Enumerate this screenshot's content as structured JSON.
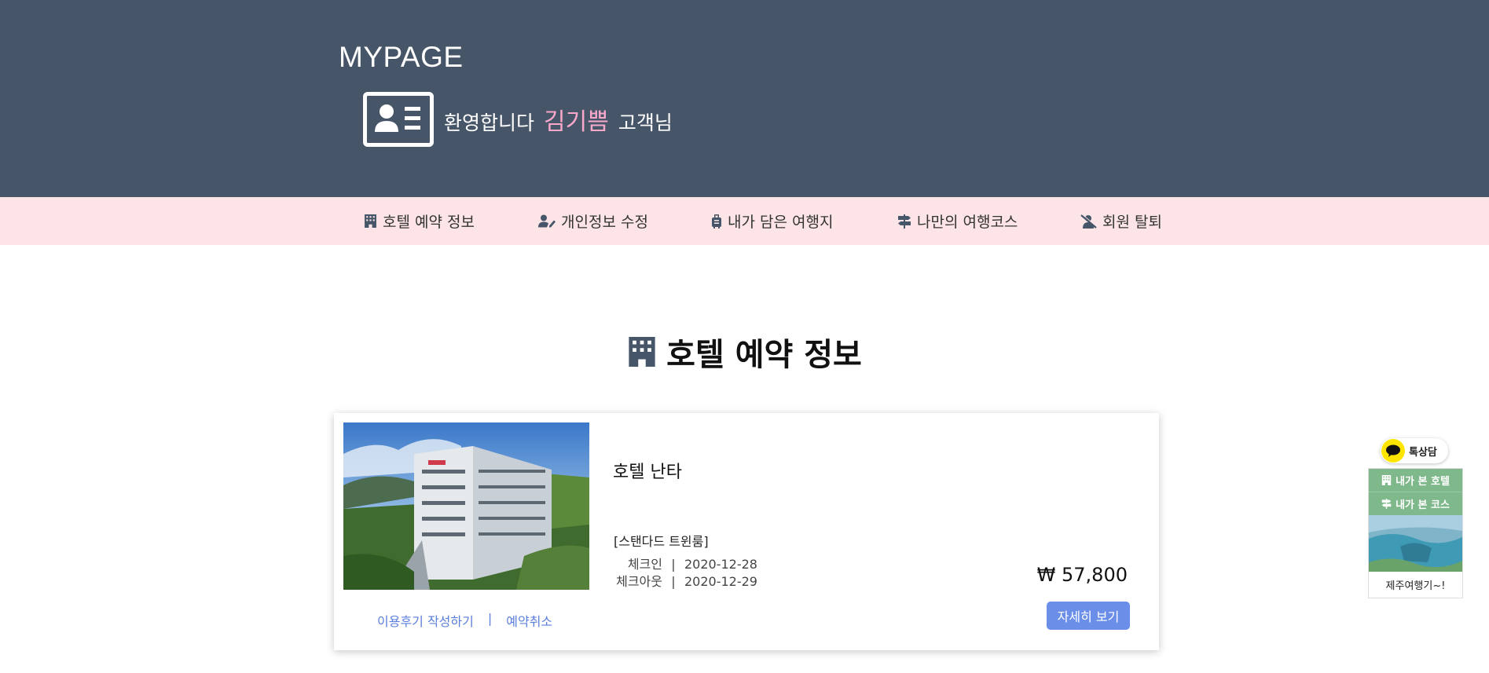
{
  "header": {
    "title": "MYPAGE",
    "welcome_prefix": "환영합니다",
    "user_name": "김기쁨",
    "welcome_suffix": "고객님"
  },
  "nav": {
    "items": [
      {
        "label": "호텔 예약 정보",
        "icon": "hotel-icon"
      },
      {
        "label": "개인정보 수정",
        "icon": "user-edit-icon"
      },
      {
        "label": "내가 담은 여행지",
        "icon": "luggage-icon"
      },
      {
        "label": "나만의 여행코스",
        "icon": "signpost-icon"
      },
      {
        "label": "회원 탈퇴",
        "icon": "user-slash-icon"
      }
    ]
  },
  "section": {
    "title": "호텔 예약 정보",
    "icon": "hotel-icon"
  },
  "reservation": {
    "hotel_name": "호텔 난타",
    "room_type": "[스탠다드 트윈룸]",
    "checkin_label": "체크인",
    "checkin_date": "2020-12-28",
    "checkout_label": "체크아웃",
    "checkout_date": "2020-12-29",
    "separator": "|",
    "price": "₩ 57,800",
    "detail_button": "자세히 보기",
    "review_link": "이용후기 작성하기",
    "link_separator": "|",
    "cancel_link": "예약취소"
  },
  "sidebar": {
    "kakao_label": "톡상담",
    "recent_hotel": "내가 본 호텔",
    "recent_course": "내가 본 코스",
    "promo_caption": "제주여행기~!"
  },
  "colors": {
    "header_bg": "#475569",
    "nav_bg": "#fde4e6",
    "user_name": "#f9a8c9",
    "button": "#6b8fe8",
    "link": "#5b7fdc",
    "widget_green": "#7fb88a"
  }
}
